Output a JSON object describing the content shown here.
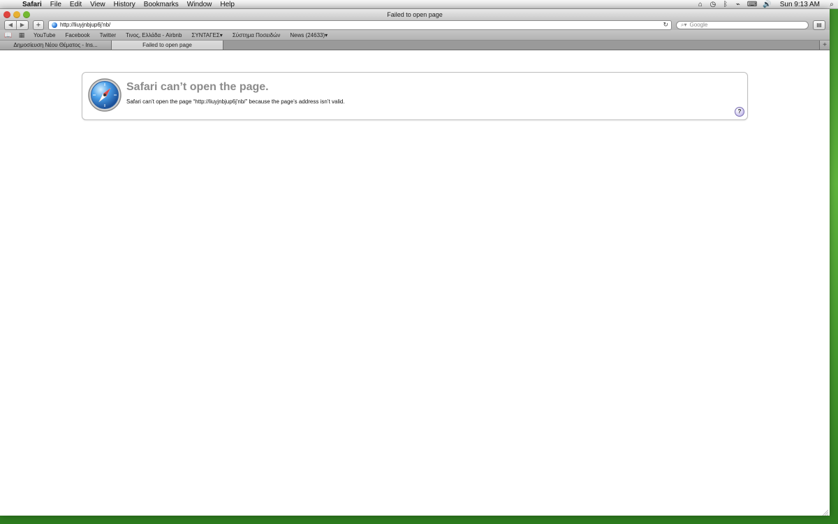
{
  "menubar": {
    "apple_icon": "apple-icon",
    "items": [
      "Safari",
      "File",
      "Edit",
      "View",
      "History",
      "Bookmarks",
      "Window",
      "Help"
    ],
    "status_icons": [
      "home-icon",
      "time-machine-icon",
      "bluetooth-icon",
      "wifi-icon",
      "keyboard-icon",
      "volume-icon"
    ],
    "clock": "Sun 9:13 AM",
    "spotlight_icon": "spotlight-icon"
  },
  "window": {
    "title": "Failed to open page"
  },
  "toolbar": {
    "back_icon": "back-icon",
    "forward_icon": "forward-icon",
    "add_bookmark_icon": "plus-icon",
    "address": "http://liuyjnbjup6j'nb/",
    "reload_icon": "reload-icon",
    "search_placeholder": "Google",
    "report_icon": "report-bug-icon"
  },
  "bookmarks": {
    "reading_icon": "reading-list-icon",
    "top_sites_icon": "top-sites-icon",
    "items": [
      "YouTube",
      "Facebook",
      "Twitter",
      "Τινος, Ελλάδα - Airbnb",
      "ΣΥΝΤΑΓΕΣ▾",
      "Σύστημα Ποσειδών",
      "News (24633)▾"
    ]
  },
  "tabs": [
    {
      "label": "Δημοσίευση Νέου Θέματος - Ins..."
    },
    {
      "label": "Failed to open page"
    }
  ],
  "error": {
    "icon": "safari-compass-icon",
    "title": "Safari can’t open the page.",
    "message": "Safari can’t open the page “http://liuyjnbjup6j'nb/” because the page’s address isn’t valid.",
    "help_label": "?"
  }
}
